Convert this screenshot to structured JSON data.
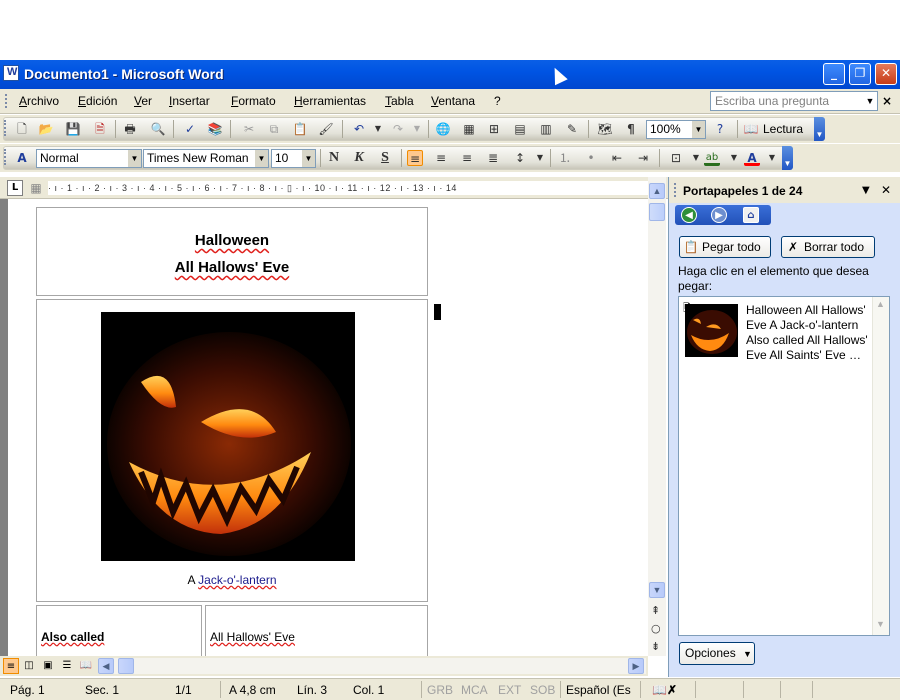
{
  "window": {
    "title": "Documento1 - Microsoft Word",
    "buttons": {
      "minimize": "_",
      "restore": "❐",
      "close": "✕"
    }
  },
  "menubar": {
    "items": [
      "Archivo",
      "Edición",
      "Ver",
      "Insertar",
      "Formato",
      "Herramientas",
      "Tabla",
      "Ventana",
      "?"
    ],
    "ask_placeholder": "Escriba una pregunta",
    "close": "×"
  },
  "standard_toolbar": {
    "zoom": "100%",
    "reading": "Lectura"
  },
  "format_toolbar": {
    "style": "Normal",
    "font": "Times New Roman",
    "size": "10",
    "bold": "N",
    "italic": "K",
    "underline": "S",
    "colors": {
      "highlight": "#ffff00",
      "font_color": "#ff0000"
    }
  },
  "ruler": {
    "tab_selector": "L",
    "marks": "· ı · 1 · ı · 2 · ı · 3 · ı · 4 · ı · 5 · ı · 6 · ı · 7 · ı · 8 · ı · ▯ · ı · 10 · ı · 11 · ı · 12 · ı · 13 · ı · 14"
  },
  "document": {
    "title_line1": "Halloween",
    "title_line2": "All Hallows' Eve",
    "image_alt": "jack-o'-lantern photo",
    "caption_prefix": "A ",
    "caption_link": "Jack-o'-lantern",
    "row_label": "Also called",
    "row_value": "All Hallows' Eve"
  },
  "clipboard_pane": {
    "title": "Portapapeles 1 de 24",
    "paste_all": "Pegar todo",
    "clear_all": "Borrar todo",
    "hint": "Haga clic en el elemento que desea pegar:",
    "items": [
      {
        "text": "Halloween All Hallows' Eve A Jack-o'-lantern Also called All Hallows' Eve All Saints' Eve …"
      }
    ],
    "options": "Opciones"
  },
  "statusbar": {
    "page": "Pág. 1",
    "section": "Sec. 1",
    "pages": "1/1",
    "at": "A 4,8 cm",
    "line": "Lín. 3",
    "col": "Col. 1",
    "grb": "GRB",
    "mca": "MCA",
    "ext": "EXT",
    "sob": "SOB",
    "language": "Español (Es"
  }
}
